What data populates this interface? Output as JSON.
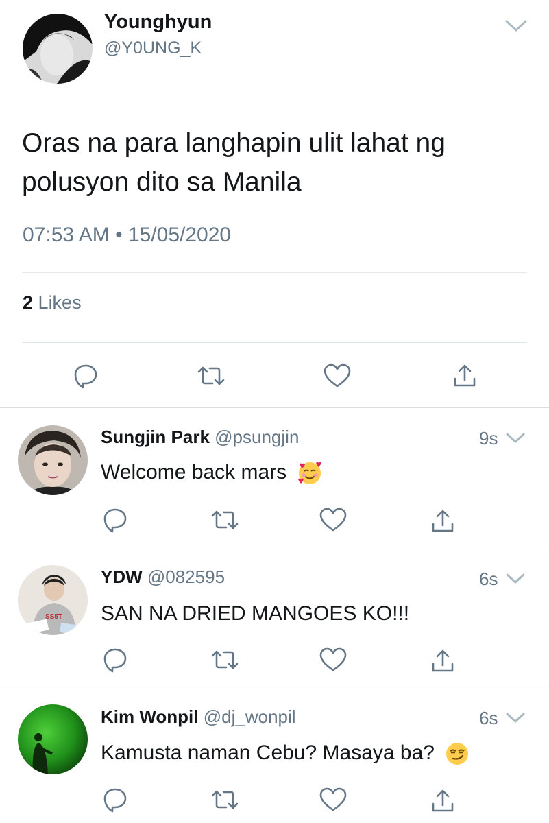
{
  "tweet": {
    "author_name": "Younghyun",
    "author_handle": "@Y0UNG_K",
    "text": "Oras na para langhapin ulit lahat ng polusyon dito sa Manila",
    "timestamp": "07:53 AM • 15/05/2020",
    "likes_count": "2",
    "likes_label": "Likes"
  },
  "icons": {
    "caret": "chevron-down-icon",
    "reply": "reply-icon",
    "retweet": "retweet-icon",
    "like": "heart-icon",
    "share": "share-icon"
  },
  "replies": [
    {
      "name": "Sungjin Park",
      "handle": "@psungjin",
      "time": "9s",
      "text": "Welcome back mars",
      "emoji": "smiling-face-with-hearts-emoji"
    },
    {
      "name": "YDW",
      "handle": "@082595",
      "time": "6s",
      "text": "SAN NA DRIED MANGOES KO!!!",
      "emoji": ""
    },
    {
      "name": "Kim Wonpil",
      "handle": "@dj_wonpil",
      "time": "6s",
      "text": "Kamusta naman Cebu? Masaya ba?",
      "emoji": "smirking-face-emoji"
    }
  ],
  "colors": {
    "text": "#14171a",
    "secondary": "#657786",
    "divider": "#e1e8ed",
    "chevron": "#aab8c2"
  }
}
